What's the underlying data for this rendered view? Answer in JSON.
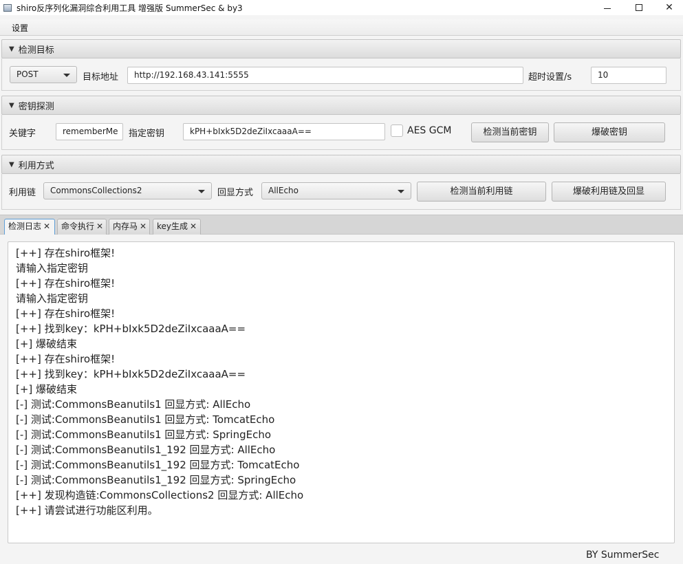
{
  "window": {
    "title": "shiro反序列化漏洞综合利用工具 增强版 SummerSec & by3",
    "minimize": "—",
    "maximize": "☐",
    "close": "✕"
  },
  "menu": {
    "settings": "设置"
  },
  "detect_target": {
    "title": "检测目标",
    "method": "POST",
    "url_label": "目标地址",
    "url_value": "http://192.168.43.141:5555",
    "timeout_label": "超时设置/s",
    "timeout_value": "10"
  },
  "key_detect": {
    "title": "密钥探测",
    "keyword_label": "关键字",
    "keyword_value": "rememberMe",
    "key_label": "指定密钥",
    "key_value": "kPH+bIxk5D2deZiIxcaaaA==",
    "aes_gcm_label": "AES GCM",
    "check_key_button": "检测当前密钥",
    "brute_key_button": "爆破密钥"
  },
  "exploit": {
    "title": "利用方式",
    "chain_label": "利用链",
    "chain_value": "CommonsCollections2",
    "echo_label": "回显方式",
    "echo_value": "AllEcho",
    "check_chain_button": "检测当前利用链",
    "brute_chain_button": "爆破利用链及回显"
  },
  "tabs": [
    {
      "label": "检测日志",
      "close": "✕"
    },
    {
      "label": "命令执行",
      "close": "✕"
    },
    {
      "label": "内存马",
      "close": "✕"
    },
    {
      "label": "key生成",
      "close": "✕"
    }
  ],
  "log": [
    "[++] 存在shiro框架!",
    "请输入指定密钥",
    "[++] 存在shiro框架!",
    "请输入指定密钥",
    "[++] 存在shiro框架!",
    "[++] 找到key：kPH+bIxk5D2deZiIxcaaaA==",
    "[+] 爆破结束",
    "[++] 存在shiro框架!",
    "[++] 找到key：kPH+bIxk5D2deZiIxcaaaA==",
    "[+] 爆破结束",
    "[-] 测试:CommonsBeanutils1  回显方式: AllEcho",
    "[-] 测试:CommonsBeanutils1  回显方式: TomcatEcho",
    "[-] 测试:CommonsBeanutils1  回显方式: SpringEcho",
    "[-] 测试:CommonsBeanutils1_192  回显方式: AllEcho",
    "[-] 测试:CommonsBeanutils1_192  回显方式: TomcatEcho",
    "[-] 测试:CommonsBeanutils1_192  回显方式: SpringEcho",
    "[++] 发现构造链:CommonsCollections2  回显方式: AllEcho",
    "[++] 请尝试进行功能区利用。"
  ],
  "footer": "BY   SummerSec",
  "pane_arrow": "▼",
  "colors": {
    "active_tab_border": "#5f9fd8",
    "background": "#f4f4f4"
  }
}
